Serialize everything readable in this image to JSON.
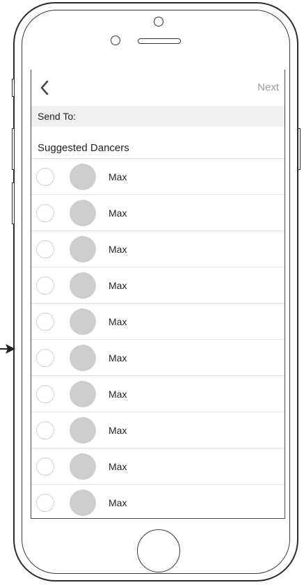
{
  "header": {
    "back_icon": "chevron-left-icon",
    "next_label": "Next"
  },
  "send_to": {
    "label": "Send To:"
  },
  "suggested": {
    "title": "Suggested Dancers",
    "items": [
      {
        "name": "Max"
      },
      {
        "name": "Max"
      },
      {
        "name": "Max"
      },
      {
        "name": "Max"
      },
      {
        "name": "Max"
      },
      {
        "name": "Max"
      },
      {
        "name": "Max"
      },
      {
        "name": "Max"
      },
      {
        "name": "Max"
      },
      {
        "name": "Max"
      }
    ]
  },
  "colors": {
    "avatar_placeholder": "#cdcdcd",
    "next_text": "#9a9a9a",
    "send_to_bg": "#efefef"
  }
}
